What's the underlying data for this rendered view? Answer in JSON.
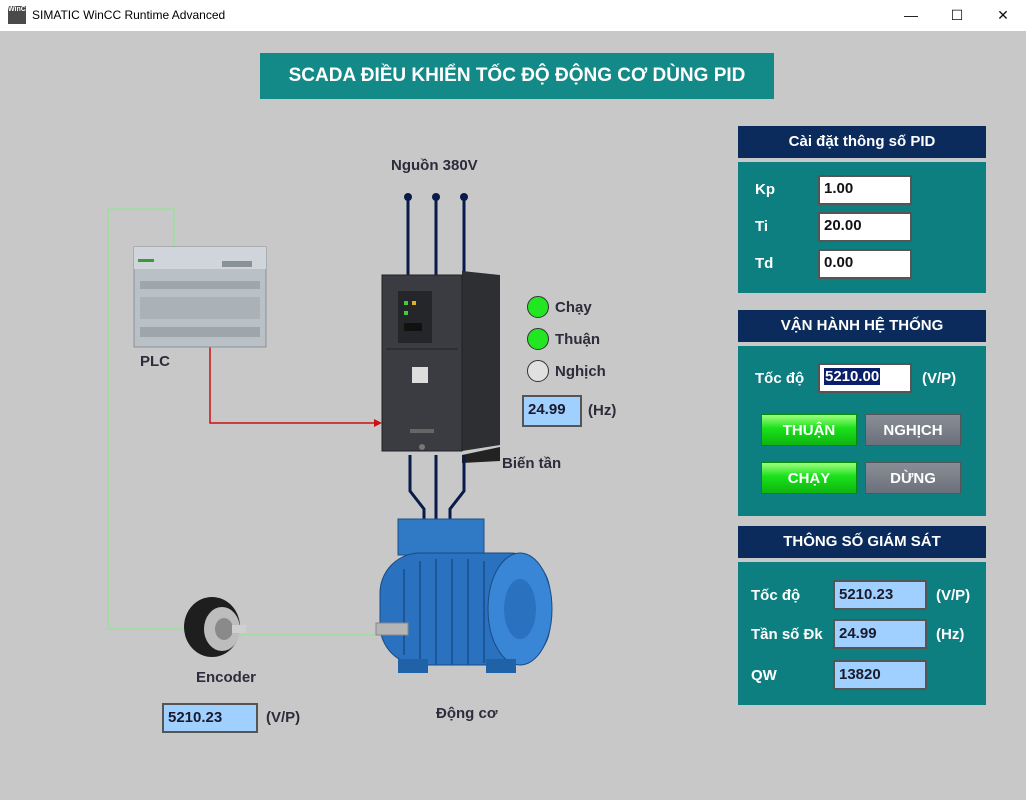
{
  "window": {
    "icon_text": "WinCC",
    "title": "SIMATIC WinCC Runtime Advanced",
    "minimize_glyph": "—",
    "maximize_glyph": "☐",
    "close_glyph": "✕"
  },
  "header": {
    "title": "SCADA ĐIỀU KHIỂN TỐC ĐỘ ĐỘNG CƠ DÙNG PID"
  },
  "diagram": {
    "power_label": "Nguồn 380V",
    "plc_label": "PLC",
    "inverter_label": "Biến tần",
    "motor_label": "Động cơ",
    "encoder_label": "Encoder",
    "encoder_value": "5210.23",
    "encoder_unit": "(V/P)",
    "freq_value": "24.99",
    "freq_unit": "(Hz)",
    "indicators": [
      {
        "label": "Chạy",
        "color": "#22e622"
      },
      {
        "label": "Thuận",
        "color": "#22e622"
      },
      {
        "label": "Nghịch",
        "color": "#e0e0e0"
      }
    ]
  },
  "pid_panel": {
    "title": "Cài đặt thông số PID",
    "rows": [
      {
        "label": "Kp",
        "value": "1.00"
      },
      {
        "label": "Ti",
        "value": "20.00"
      },
      {
        "label": "Td",
        "value": "0.00"
      }
    ]
  },
  "operation_panel": {
    "title": "VẬN HÀNH HỆ THỐNG",
    "speed_label": "Tốc độ",
    "speed_value": "5210.00",
    "speed_unit": "(V/P)",
    "forward_label": "THUẬN",
    "reverse_label": "NGHỊCH",
    "run_label": "CHẠY",
    "stop_label": "DỪNG"
  },
  "monitor_panel": {
    "title": "THÔNG SỐ GIÁM SÁT",
    "rows": [
      {
        "label": "Tốc độ",
        "value": "5210.23",
        "unit": "(V/P)"
      },
      {
        "label": "Tần số Đk",
        "value": "24.99",
        "unit": "(Hz)"
      },
      {
        "label": "QW",
        "value": "13820",
        "unit": ""
      }
    ]
  },
  "colors": {
    "banner": "#148a88",
    "panel_header": "#0a2b5c",
    "panel_body": "#0d7f80",
    "led_on": "#22e622",
    "button_on": "#19e01b",
    "button_off": "#6c707a"
  }
}
